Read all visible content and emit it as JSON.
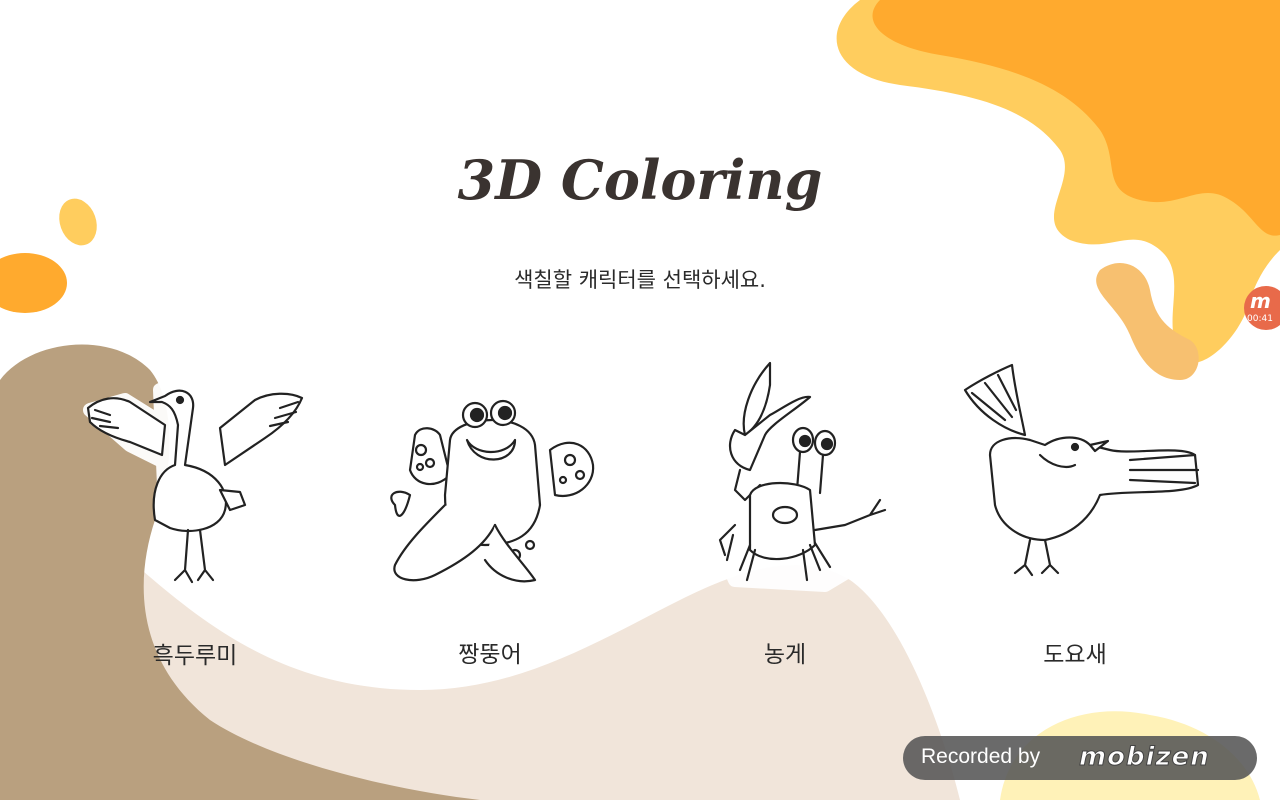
{
  "app": {
    "title": "3D Coloring",
    "subtitle": "색칠할 캐릭터를 선택하세요."
  },
  "characters": [
    {
      "label": "흑두루미",
      "icon": "crane-outline"
    },
    {
      "label": "짱뚱어",
      "icon": "mudskipper-outline"
    },
    {
      "label": "농게",
      "icon": "crab-outline"
    },
    {
      "label": "도요새",
      "icon": "sandpiper-outline"
    }
  ],
  "recorder": {
    "badge_logo": "m",
    "badge_time": "00:41",
    "watermark_text": "Recorded by",
    "watermark_brand": "mobizen"
  },
  "colors": {
    "orange": "#ffaa2e",
    "yellow": "#ffcd5e",
    "brown": "#b9a07f",
    "beige": "#f1e5da",
    "pale_yellow": "#fff2b8",
    "outline": "#222222",
    "badge": "#e86a4a"
  }
}
